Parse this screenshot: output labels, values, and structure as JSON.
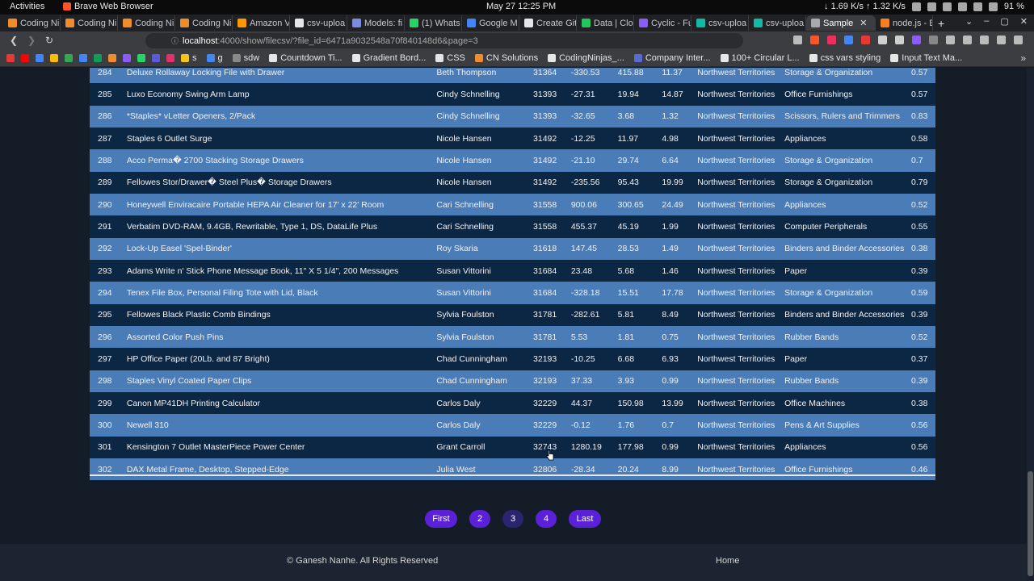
{
  "system_bar": {
    "activities": "Activities",
    "app_name": "Brave Web Browser",
    "clock": "May 27  12:25 PM",
    "network": "↓ 1.69 K/s ↑ 1.32 K/s",
    "battery": "91 %"
  },
  "tabs": [
    {
      "label": "Coding Ni",
      "color": "#f08c2c"
    },
    {
      "label": "Coding Ni",
      "color": "#f08c2c"
    },
    {
      "label": "Coding Ni",
      "color": "#f08c2c"
    },
    {
      "label": "Coding Ni",
      "color": "#f08c2c"
    },
    {
      "label": "Amazon V",
      "color": "#ff9900"
    },
    {
      "label": "csv-uploa",
      "color": "#e6e6e6"
    },
    {
      "label": "Models: fi",
      "color": "#7b8cde"
    },
    {
      "label": "(1) Whats",
      "color": "#25d366"
    },
    {
      "label": "Google M",
      "color": "#4285f4"
    },
    {
      "label": "Create Git",
      "color": "#e6e6e6"
    },
    {
      "label": "Data | Clo",
      "color": "#22c55e"
    },
    {
      "label": "Cyclic - Fu",
      "color": "#8b5cf6"
    },
    {
      "label": "csv-uploa",
      "color": "#14b8a6"
    },
    {
      "label": "csv-uploa",
      "color": "#14b8a6"
    },
    {
      "label": "Sample",
      "color": "#aaaaaa",
      "active": true
    },
    {
      "label": "node.js - E",
      "color": "#f48024"
    }
  ],
  "address_bar": {
    "host": "localhost",
    "path": ":4000/show/filecsv/?file_id=6471a9032548a70f840148d6&page=3"
  },
  "bookmarks": [
    {
      "label": "",
      "color": "#e53935"
    },
    {
      "label": "",
      "color": "#ff0000"
    },
    {
      "label": "",
      "color": "#4285f4"
    },
    {
      "label": "",
      "color": "#fbbc05"
    },
    {
      "label": "",
      "color": "#34a853"
    },
    {
      "label": "",
      "color": "#4285f4"
    },
    {
      "label": "",
      "color": "#0f9d58"
    },
    {
      "label": "",
      "color": "#f08c2c"
    },
    {
      "label": "",
      "color": "#8b5cf6"
    },
    {
      "label": "",
      "color": "#25d366"
    },
    {
      "label": "",
      "color": "#5b5bd6"
    },
    {
      "label": "",
      "color": "#e1306c"
    },
    {
      "label": "s",
      "color": "#f5c518"
    },
    {
      "label": "g",
      "color": "#4285f4"
    },
    {
      "label": "sdw",
      "color": "#888888"
    },
    {
      "label": "Countdown Ti...",
      "color": "#e6e6e6"
    },
    {
      "label": "Gradient Bord...",
      "color": "#e6e6e6"
    },
    {
      "label": "CSS",
      "color": "#e6e6e6"
    },
    {
      "label": "CN Solutions",
      "color": "#f08c2c"
    },
    {
      "label": "CodingNinjas_...",
      "color": "#e6e6e6"
    },
    {
      "label": "Company Inter...",
      "color": "#5b6bd6"
    },
    {
      "label": "100+ Circular L...",
      "color": "#e6e6e6"
    },
    {
      "label": "css vars styling",
      "color": "#e6e6e6"
    },
    {
      "label": "Input Text Ma...",
      "color": "#e6e6e6"
    }
  ],
  "rows": [
    {
      "idx": "284",
      "name": "Deluxe Rollaway Locking File with Drawer",
      "customer": "Beth Thompson",
      "order": "31364",
      "profit": "-330.53",
      "price": "415.88",
      "ship": "11.37",
      "region": "Northwest Territories",
      "category": "Storage & Organization",
      "discount": "0.57"
    },
    {
      "idx": "285",
      "name": "Luxo Economy Swing Arm Lamp",
      "customer": "Cindy Schnelling",
      "order": "31393",
      "profit": "-27.31",
      "price": "19.94",
      "ship": "14.87",
      "region": "Northwest Territories",
      "category": "Office Furnishings",
      "discount": "0.57"
    },
    {
      "idx": "286",
      "name": "*Staples* vLetter Openers, 2/Pack",
      "customer": "Cindy Schnelling",
      "order": "31393",
      "profit": "-32.65",
      "price": "3.68",
      "ship": "1.32",
      "region": "Northwest Territories",
      "category": "Scissors, Rulers and Trimmers",
      "discount": "0.83"
    },
    {
      "idx": "287",
      "name": "Staples 6 Outlet Surge",
      "customer": "Nicole Hansen",
      "order": "31492",
      "profit": "-12.25",
      "price": "11.97",
      "ship": "4.98",
      "region": "Northwest Territories",
      "category": "Appliances",
      "discount": "0.58"
    },
    {
      "idx": "288",
      "name": "Acco Perma� 2700 Stacking Storage Drawers",
      "customer": "Nicole Hansen",
      "order": "31492",
      "profit": "-21.10",
      "price": "29.74",
      "ship": "6.64",
      "region": "Northwest Territories",
      "category": "Storage & Organization",
      "discount": "0.7"
    },
    {
      "idx": "289",
      "name": "Fellowes Stor/Drawer� Steel Plus� Storage Drawers",
      "customer": "Nicole Hansen",
      "order": "31492",
      "profit": "-235.56",
      "price": "95.43",
      "ship": "19.99",
      "region": "Northwest Territories",
      "category": "Storage & Organization",
      "discount": "0.79"
    },
    {
      "idx": "290",
      "name": "Honeywell Enviracaire Portable HEPA Air Cleaner for 17' x 22' Room",
      "customer": "Cari Schnelling",
      "order": "31558",
      "profit": "900.06",
      "price": "300.65",
      "ship": "24.49",
      "region": "Northwest Territories",
      "category": "Appliances",
      "discount": "0.52"
    },
    {
      "idx": "291",
      "name": "Verbatim DVD-RAM, 9.4GB, Rewritable, Type 1, DS, DataLife Plus",
      "customer": "Cari Schnelling",
      "order": "31558",
      "profit": "455.37",
      "price": "45.19",
      "ship": "1.99",
      "region": "Northwest Territories",
      "category": "Computer Peripherals",
      "discount": "0.55"
    },
    {
      "idx": "292",
      "name": "Lock-Up Easel 'Spel-Binder'",
      "customer": "Roy Skaria",
      "order": "31618",
      "profit": "147.45",
      "price": "28.53",
      "ship": "1.49",
      "region": "Northwest Territories",
      "category": "Binders and Binder Accessories",
      "discount": "0.38"
    },
    {
      "idx": "293",
      "name": "Adams Write n' Stick Phone Message Book, 11\" X 5 1/4\", 200 Messages",
      "customer": "Susan Vittorini",
      "order": "31684",
      "profit": "23.48",
      "price": "5.68",
      "ship": "1.46",
      "region": "Northwest Territories",
      "category": "Paper",
      "discount": "0.39"
    },
    {
      "idx": "294",
      "name": "Tenex File Box, Personal Filing Tote with Lid, Black",
      "customer": "Susan Vittorini",
      "order": "31684",
      "profit": "-328.18",
      "price": "15.51",
      "ship": "17.78",
      "region": "Northwest Territories",
      "category": "Storage & Organization",
      "discount": "0.59"
    },
    {
      "idx": "295",
      "name": "Fellowes Black Plastic Comb Bindings",
      "customer": "Sylvia Foulston",
      "order": "31781",
      "profit": "-282.61",
      "price": "5.81",
      "ship": "8.49",
      "region": "Northwest Territories",
      "category": "Binders and Binder Accessories",
      "discount": "0.39"
    },
    {
      "idx": "296",
      "name": "Assorted Color Push Pins",
      "customer": "Sylvia Foulston",
      "order": "31781",
      "profit": "5.53",
      "price": "1.81",
      "ship": "0.75",
      "region": "Northwest Territories",
      "category": "Rubber Bands",
      "discount": "0.52"
    },
    {
      "idx": "297",
      "name": "HP Office Paper (20Lb. and 87 Bright)",
      "customer": "Chad Cunningham",
      "order": "32193",
      "profit": "-10.25",
      "price": "6.68",
      "ship": "6.93",
      "region": "Northwest Territories",
      "category": "Paper",
      "discount": "0.37"
    },
    {
      "idx": "298",
      "name": "Staples Vinyl Coated Paper Clips",
      "customer": "Chad Cunningham",
      "order": "32193",
      "profit": "37.33",
      "price": "3.93",
      "ship": "0.99",
      "region": "Northwest Territories",
      "category": "Rubber Bands",
      "discount": "0.39"
    },
    {
      "idx": "299",
      "name": "Canon MP41DH Printing Calculator",
      "customer": "Carlos Daly",
      "order": "32229",
      "profit": "44.37",
      "price": "150.98",
      "ship": "13.99",
      "region": "Northwest Territories",
      "category": "Office Machines",
      "discount": "0.38"
    },
    {
      "idx": "300",
      "name": "Newell 310",
      "customer": "Carlos Daly",
      "order": "32229",
      "profit": "-0.12",
      "price": "1.76",
      "ship": "0.7",
      "region": "Northwest Territories",
      "category": "Pens & Art Supplies",
      "discount": "0.56"
    },
    {
      "idx": "301",
      "name": "Kensington 7 Outlet MasterPiece Power Center",
      "customer": "Grant Carroll",
      "order": "32743",
      "profit": "1280.19",
      "price": "177.98",
      "ship": "0.99",
      "region": "Northwest Territories",
      "category": "Appliances",
      "discount": "0.56"
    },
    {
      "idx": "302",
      "name": "DAX Metal Frame, Desktop, Stepped-Edge",
      "customer": "Julia West",
      "order": "32806",
      "profit": "-28.34",
      "price": "20.24",
      "ship": "8.99",
      "region": "Northwest Territories",
      "category": "Office Furnishings",
      "discount": "0.46"
    }
  ],
  "pagination": {
    "first": "First",
    "pages": [
      "2",
      "3",
      "4"
    ],
    "current": "3",
    "last": "Last"
  },
  "footer": {
    "copyright": "© Ganesh Nanhe. All Rights Reserved",
    "home": "Home"
  },
  "colors": {
    "row_dark": "#0c2744",
    "row_light": "#4a7cb8",
    "page_bg": "#141c27",
    "button": "#5b21d8",
    "button_current": "#2b2470"
  }
}
